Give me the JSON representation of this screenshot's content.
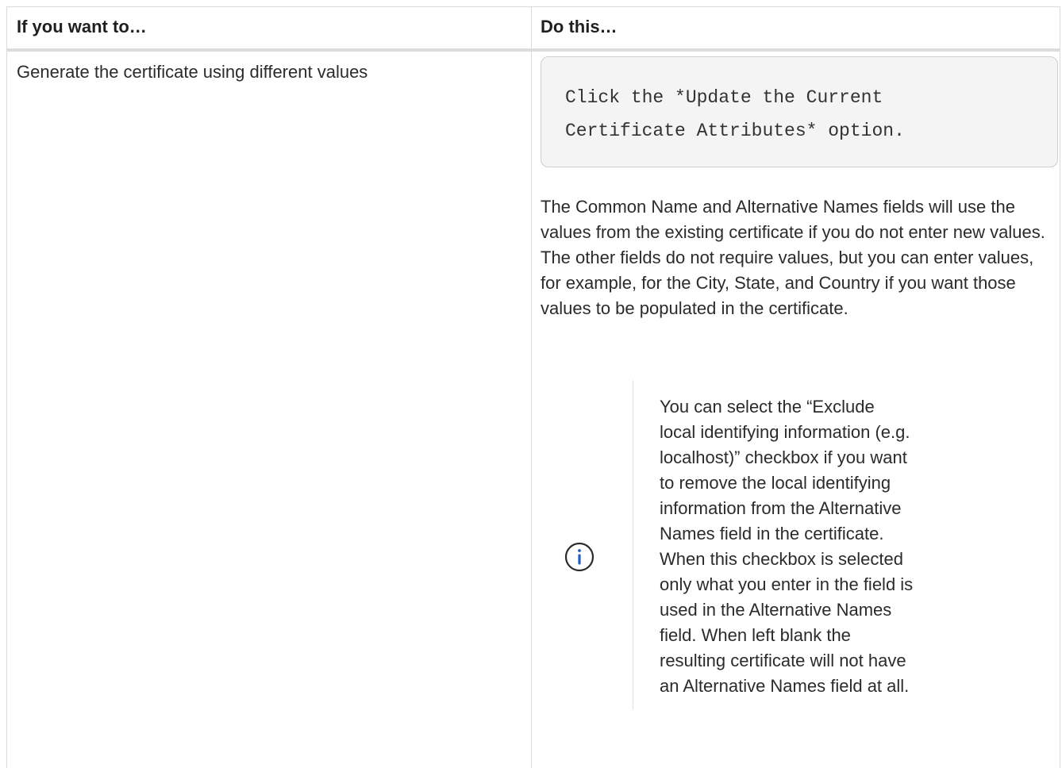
{
  "table": {
    "headers": [
      "If you want to…",
      "Do this…"
    ],
    "row": {
      "want": "Generate the certificate using different values",
      "code": "Click the *Update the Current\nCertificate Attributes* option.",
      "description": "The Common Name and Alternative Names fields will use the values from the existing certificate if you do not enter new values. The other fields do not require values, but you can enter values, for example, for the City, State, and Country if you want those values to be populated in the certificate.",
      "note": {
        "icon": "info-icon",
        "text": "You can select the “Exclude local identifying information (e.g. localhost)” checkbox if you want to remove the local identifying information from the Alternative Names field in the certificate. When this checkbox is selected only what you enter in the field is used in the Alternative Names field. When left blank the resulting certificate will not have an Alternative Names field at all."
      }
    }
  },
  "colors": {
    "border": "#dadada",
    "code_background": "#f4f4f4",
    "info_icon": "#1f5fbf"
  }
}
